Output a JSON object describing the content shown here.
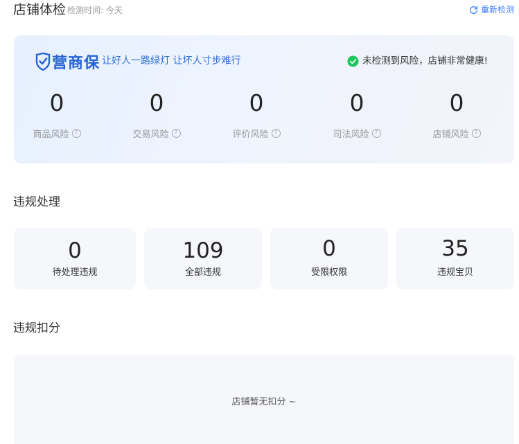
{
  "header": {
    "title": "店铺体检",
    "check_time": "检测时间: 今天",
    "recheck_label": "重新检测"
  },
  "health": {
    "brand": "营商保",
    "slogan": "让好人一路绿灯 让坏人寸步难行",
    "status": "未检测到风险，店铺非常健康!",
    "risks": [
      {
        "value": "0",
        "label": "商品风险"
      },
      {
        "value": "0",
        "label": "交易风险"
      },
      {
        "value": "0",
        "label": "评价风险"
      },
      {
        "value": "0",
        "label": "司法风险"
      },
      {
        "value": "0",
        "label": "店铺风险"
      }
    ]
  },
  "violation": {
    "title": "违规处理",
    "cards": [
      {
        "value": "0",
        "label": "待处理违规"
      },
      {
        "value": "109",
        "label": "全部违规"
      },
      {
        "value": "0",
        "label": "受限权限"
      },
      {
        "value": "35",
        "label": "违规宝贝"
      }
    ]
  },
  "deduction": {
    "title": "违规扣分",
    "empty_text": "店铺暂无扣分 ~"
  },
  "colors": {
    "accent": "#3d7fff",
    "brand": "#2563d4",
    "success": "#21c55d"
  },
  "icons": {
    "recheck": "refresh-icon",
    "status": "check-circle-icon",
    "help": "question-circle-icon"
  }
}
